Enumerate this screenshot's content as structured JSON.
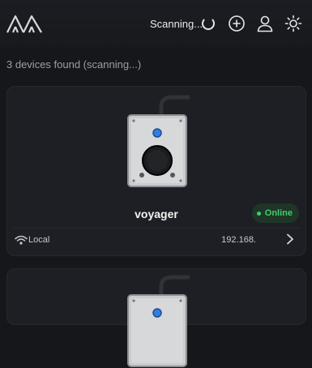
{
  "header": {
    "scan_status": "Scanning...",
    "icons": [
      "logo",
      "spinner-icon",
      "add-circle-icon",
      "user-icon",
      "sun-icon"
    ]
  },
  "status_line": "3 devices found (scanning...)",
  "devices": [
    {
      "name": "voyager",
      "status": "Online",
      "connection": "Local",
      "ip": "192.168."
    },
    {
      "name": "",
      "status": "",
      "connection": "",
      "ip": ""
    }
  ],
  "colors": {
    "background": "#15171b",
    "card": "#1d1f24",
    "online": "#3ecf6a",
    "led": "#2f7fe0"
  }
}
